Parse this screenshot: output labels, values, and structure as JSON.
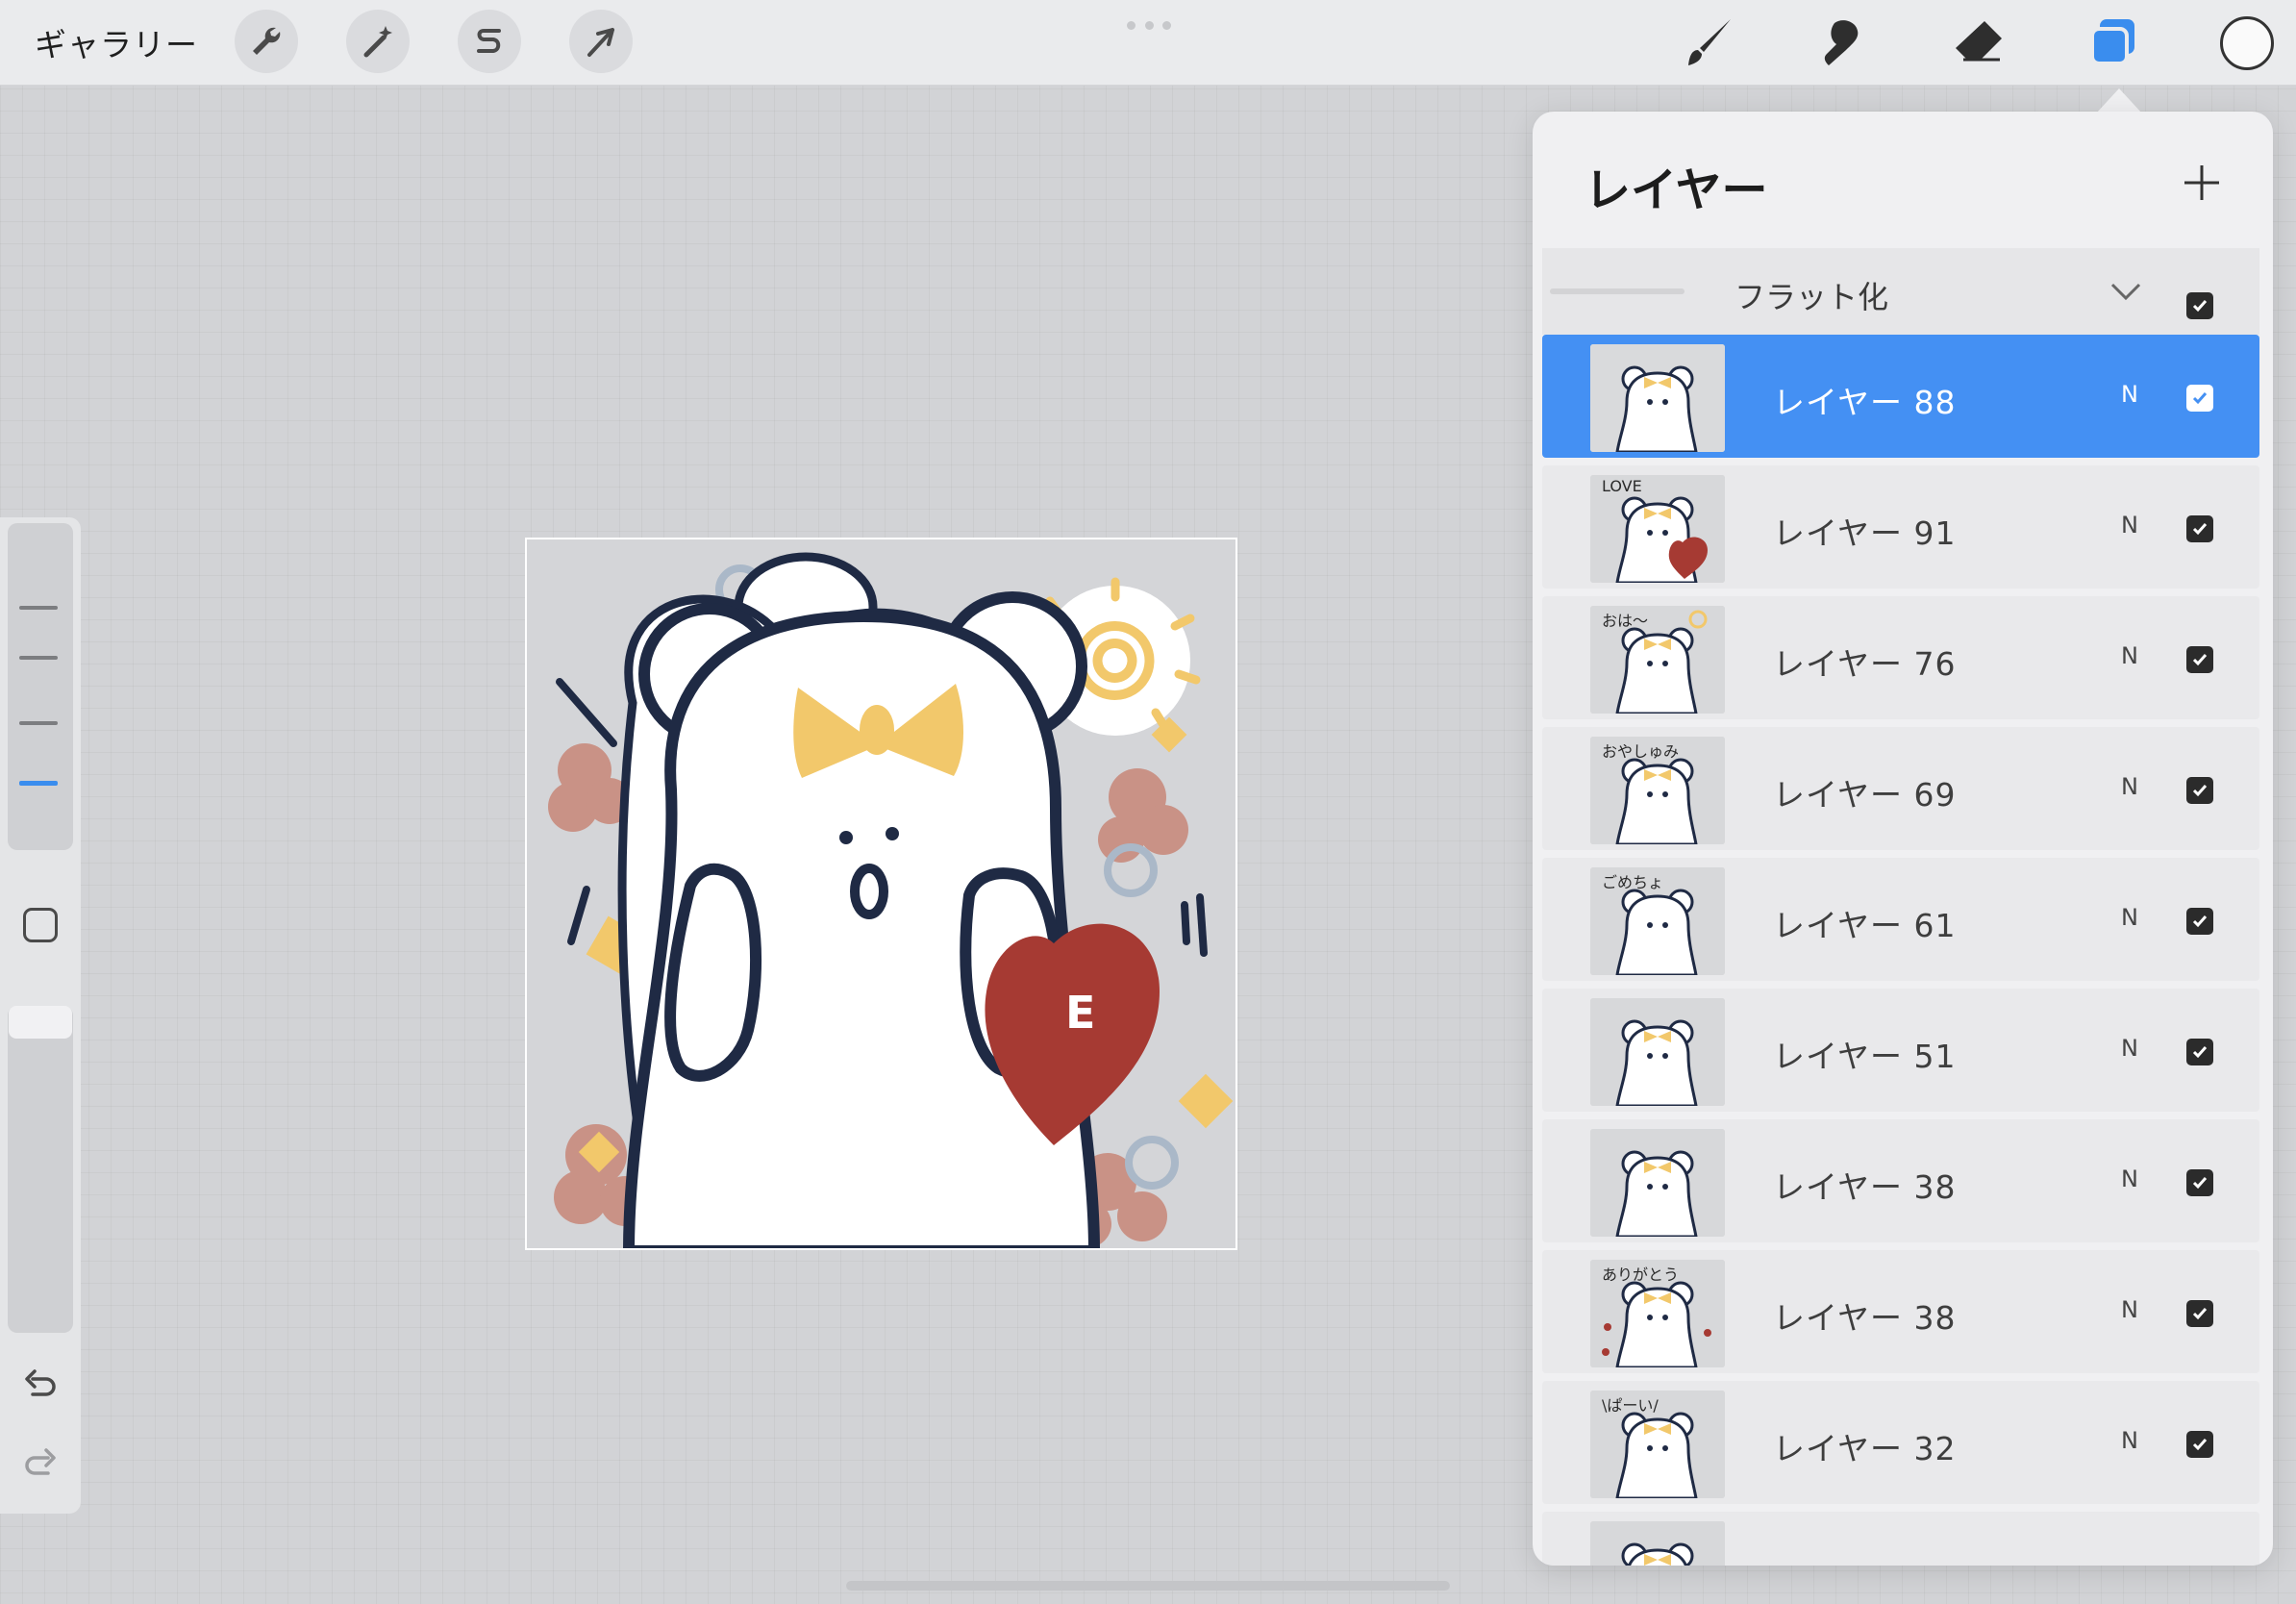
{
  "toolbar": {
    "gallery_label": "ギャラリー",
    "left_tools": [
      "wrench-icon",
      "magic-wand-icon",
      "selection-s-icon",
      "transform-arrow-icon"
    ],
    "right_tools": [
      "brush-icon",
      "smudge-icon",
      "eraser-icon",
      "layers-icon"
    ],
    "active_tool": "layers-icon",
    "color_well": "#fafafa",
    "accent": "#3a8dee"
  },
  "sidebar": {
    "size_slider_ticks": 4,
    "active_tick": 4,
    "undo_icon": "undo-icon",
    "redo_icon": "redo-icon"
  },
  "layers_panel": {
    "title": "レイヤー",
    "add_icon": "plus-icon",
    "flatten_label": "フラット化",
    "flatten_checked": true,
    "selected_color": "#4490f3",
    "layers": [
      {
        "name": "レイヤー 88",
        "mode": "N",
        "visible": true,
        "selected": true
      },
      {
        "name": "レイヤー 91",
        "mode": "N",
        "visible": true,
        "selected": false
      },
      {
        "name": "レイヤー 76",
        "mode": "N",
        "visible": true,
        "selected": false
      },
      {
        "name": "レイヤー 69",
        "mode": "N",
        "visible": true,
        "selected": false
      },
      {
        "name": "レイヤー 61",
        "mode": "N",
        "visible": true,
        "selected": false
      },
      {
        "name": "レイヤー 51",
        "mode": "N",
        "visible": true,
        "selected": false
      },
      {
        "name": "レイヤー 38",
        "mode": "N",
        "visible": true,
        "selected": false
      },
      {
        "name": "レイヤー 38",
        "mode": "N",
        "visible": true,
        "selected": false
      },
      {
        "name": "レイヤー 32",
        "mode": "N",
        "visible": true,
        "selected": false
      }
    ]
  },
  "canvas": {
    "heart_text": "E",
    "thumb_texts": [
      "LOVE",
      "おは〜",
      "おやしゅみ",
      "ごめちょ",
      "ありがとう",
      "\\ぱーい/"
    ]
  },
  "colors": {
    "outline": "#1f2a44",
    "bow": "#f2c86b",
    "heart": "#a63a33",
    "flower": "#c99286",
    "swirl": "#aab8c8"
  }
}
